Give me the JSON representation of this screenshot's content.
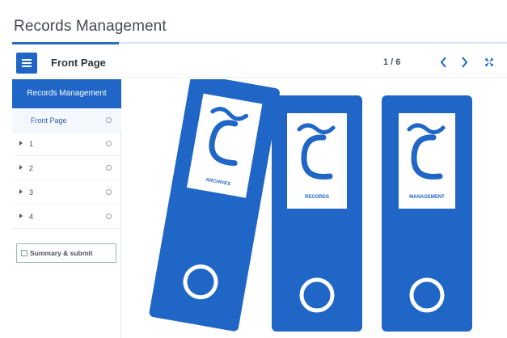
{
  "app": {
    "title": "Records Management"
  },
  "topbar": {
    "page_title": "Front Page",
    "page_counter": "1 / 6"
  },
  "sidebar": {
    "header": "Records Management",
    "items": [
      {
        "label": "Front Page",
        "active": true
      },
      {
        "label": "1",
        "active": false
      },
      {
        "label": "2",
        "active": false
      },
      {
        "label": "3",
        "active": false
      },
      {
        "label": "4",
        "active": false
      }
    ],
    "summary_button": "Summary & submit"
  },
  "binders": [
    {
      "label": "ARCHIVES"
    },
    {
      "label": "RECORDS"
    },
    {
      "label": "MANAGEMENT"
    }
  ],
  "colors": {
    "primary": "#1f66c6",
    "accent_border": "#8dc2a8"
  },
  "icons": [
    "menu-icon",
    "chevron-left-icon",
    "chevron-right-icon",
    "expand-icon",
    "circle-status-icon",
    "checkbox-icon"
  ]
}
